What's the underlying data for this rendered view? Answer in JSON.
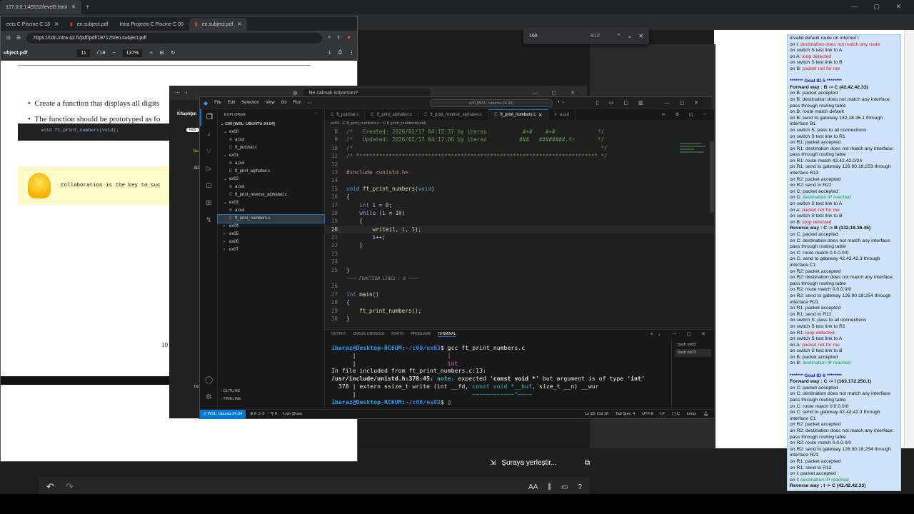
{
  "browser_tab_top": {
    "url_tab": "127.0.0.1:49152/level9.html"
  },
  "find_bar": {
    "query": "168",
    "count": "3/12"
  },
  "pdf": {
    "tabs": [
      "ects C Piscine C 13",
      "en.subject.pdf",
      "Intra Projects C Piscine C 00",
      "en.subject.pdf"
    ],
    "url": "https://cdn.intra.42.fr/pdf/pdf/197175/en.subject.pdf",
    "title": "ubject.pdf",
    "page": "11",
    "total": "/ 18",
    "zoom": "137%",
    "bullet1": "Create a function that displays all digits",
    "bullet2": "The function should be prototyped as fo",
    "code": "void ft_print_numbers(void);",
    "tip": "Collaboration is the key to suc",
    "page_number": "10"
  },
  "edge": {
    "address": "Ne calmak istiyorsun?",
    "sidebar_title": "Kitaplığın",
    "chip": "Indir",
    "label_bu": "bu",
    "label_ad": "AD",
    "label_he": "He"
  },
  "vscode": {
    "menu": [
      "File",
      "Edit",
      "Selection",
      "View",
      "Go",
      "Run"
    ],
    "search": "c00 [WSL: Ubuntu-24.04]",
    "explorer_header": "EXPLORER",
    "root": "C00 [WSL: UBUNTU-24.04]",
    "tree": [
      {
        "label": "ex00",
        "type": "folder",
        "open": true,
        "depth": 0
      },
      {
        "label": "a.out",
        "type": "file",
        "depth": 1
      },
      {
        "label": "ft_putchar.c",
        "type": "c",
        "depth": 1
      },
      {
        "label": "ex01",
        "type": "folder",
        "open": true,
        "depth": 0
      },
      {
        "label": "a.out",
        "type": "file",
        "depth": 1
      },
      {
        "label": "ft_print_alphabet.c",
        "type": "c",
        "depth": 1
      },
      {
        "label": "ex02",
        "type": "folder",
        "open": true,
        "depth": 0
      },
      {
        "label": "a.out",
        "type": "file",
        "depth": 1
      },
      {
        "label": "ft_print_reverse_alphabet.c",
        "type": "c",
        "depth": 1
      },
      {
        "label": "ex03",
        "type": "folder",
        "open": true,
        "depth": 0
      },
      {
        "label": "a.out",
        "type": "file",
        "depth": 1
      },
      {
        "label": "ft_print_numbers.c",
        "type": "c",
        "depth": 1,
        "selected": true
      },
      {
        "label": "ex04",
        "type": "folder",
        "open": false,
        "depth": 0
      },
      {
        "label": "ex05",
        "type": "folder",
        "open": false,
        "depth": 0
      },
      {
        "label": "ex06",
        "type": "folder",
        "open": false,
        "depth": 0
      },
      {
        "label": "ex07",
        "type": "folder",
        "open": false,
        "depth": 0
      }
    ],
    "outline": "OUTLINE",
    "timeline": "TIMELINE",
    "tabs": [
      {
        "label": "ft_putchar.c",
        "active": false
      },
      {
        "label": "ft_print_alphabet.c",
        "active": false
      },
      {
        "label": "ft_print_reverse_alphabet.c",
        "active": false
      },
      {
        "label": "ft_print_numbers.c",
        "active": true
      },
      {
        "label": "a.out",
        "active": false
      }
    ],
    "breadcrumb": "ex03 › C ft_print_numbers.c › ⊙ ft_print_numbers(void)",
    "code_lines": [
      {
        "n": "8",
        "html": "<span class='cm'>/*   Created: 2026/02/17 04:15:37 by ibaraz           #+#    #+#             */</span>"
      },
      {
        "n": "9",
        "html": "<span class='cm'>/*   Updated: 2026/02/17 04:17:06 by ibaraz          ###   ########.fr       */</span>"
      },
      {
        "n": "10",
        "html": "<span class='cm'>/*                                                                            */</span>"
      },
      {
        "n": "11",
        "html": "<span class='cm'>/* ************************************************************************** */</span>"
      },
      {
        "n": "12",
        "html": ""
      },
      {
        "n": "13",
        "html": "<span class='mac'>#include</span> <span class='str'>&lt;unistd.h&gt;</span>"
      },
      {
        "n": "14",
        "html": ""
      },
      {
        "n": "15",
        "html": "<span class='k'>void</span> <span class='f'>ft_print_numbers</span>(<span class='k'>void</span>)"
      },
      {
        "n": "16",
        "html": "{"
      },
      {
        "n": "17",
        "html": "    <span class='k'>int</span> <span class='var'>i</span> = <span class='num'>0</span>;"
      },
      {
        "n": "18",
        "html": "    <span class='kc'>while</span> (<span class='var'>i</span> &lt; <span class='num'>10</span>)"
      },
      {
        "n": "19",
        "html": "    {"
      },
      {
        "n": "20",
        "html": "        <span class='f'>write</span>(<span class='num'>1</span>, <span class='var'>i</span>, <span class='num'>1</span>);",
        "current": true
      },
      {
        "n": "21",
        "html": "        <span class='var'>i</span>++;"
      },
      {
        "n": "22",
        "html": "    }"
      },
      {
        "n": "23",
        "html": ""
      },
      {
        "n": "24",
        "html": ""
      },
      {
        "n": "25",
        "html": "}"
      },
      {
        "n": "",
        "html": "<span class='dim'>──── FUNCTION LINES : 8 ────</span>"
      },
      {
        "n": "26",
        "html": ""
      },
      {
        "n": "27",
        "html": "<span class='k'>int</span> <span class='f'>main</span>()"
      },
      {
        "n": "28",
        "html": "{"
      },
      {
        "n": "29",
        "html": "    <span class='f'>ft_print_numbers</span>();"
      },
      {
        "n": "30",
        "html": "}"
      }
    ],
    "panel_tabs": [
      "OUTPUT",
      "DEBUG CONSOLE",
      "PORTS",
      "PROBLEMS",
      "TERMINAL"
    ],
    "terminal_lines": [
      "<span class='pr'>ibaraz@Desktop-RC6UM</span>:<span class='pp'>~/c00/ex03</span>$ gcc ft_print_numbers.c",
      "      |                          <span class='mag'>|</span>",
      "      |                          <span class='mag'>int</span>",
      "In file included from ft_print_numbers.c:13:",
      "<span class='bold2'>/usr/include/unistd.h:378:45:</span> <span class='teal bold2'>note:</span> expected ‘<span class='bold2'>const void *</span>’ but argument is of type ‘<span class='bold2'>int</span>’",
      "  378 | extern ssize_t write (int __fd, <span class='teal'>const void *__buf</span>, size_t __n) __wur",
      "      |                                 <span class='teal'>~~~~~~~~~~~~^~~~~</span>",
      "<span class='pr'>ibaraz@Desktop-RC6UM</span>:<span class='pp'>~/c00/ex03</span>$ ▯"
    ],
    "terminals": [
      "bash  ex00",
      "bash  ex03"
    ],
    "status": {
      "remote": "WSL: Ubuntu-24.04",
      "errors": "⊗ 0 ⚠ 0",
      "ports": "⚲ 0",
      "live": "Live Share",
      "position": "Ln 20, Col 18",
      "tab": "Tab Size: 4",
      "enc": "UTF-8",
      "eol": "LF",
      "lang": "{ } C",
      "os": "Linux"
    }
  },
  "log": [
    {
      "t": "invalid default route on internet I",
      "c": ""
    },
    {
      "t": "on I: ",
      "c": "",
      "x": "destination does not match any route",
      "xc": "red"
    },
    {
      "t": "on switch S test link to A",
      "c": ""
    },
    {
      "t": "on A: ",
      "c": "",
      "x": "loop detected",
      "xc": "red"
    },
    {
      "t": "on switch S test link to B",
      "c": ""
    },
    {
      "t": "on B: ",
      "c": "",
      "x": "packet not for me",
      "xc": "red"
    },
    {
      "t": "",
      "c": ""
    },
    {
      "t": "******* Goal ID 5 ********",
      "c": "blu"
    },
    {
      "t": "Forward way",
      "c": "bold",
      "x": " : B -> C (42.42.42.33)",
      "xc": ""
    },
    {
      "t": "on B: packet accepted",
      "c": ""
    },
    {
      "t": "on B: destination does not match any interface: pass through routing table",
      "c": "wrap"
    },
    {
      "t": "on B: route match default",
      "c": ""
    },
    {
      "t": "on B: send to gateway 132.18.36.1 through interface B1",
      "c": "wrap"
    },
    {
      "t": "on switch S: pass to all connections",
      "c": ""
    },
    {
      "t": "on switch S test link to R1",
      "c": ""
    },
    {
      "t": "on R1: packet accepted",
      "c": ""
    },
    {
      "t": "on R1: destination does not match any interface: pass through routing table",
      "c": "wrap"
    },
    {
      "t": "on R1: route match 42.42.42.0/24",
      "c": ""
    },
    {
      "t": "on R1: send to gateway 126.90.18.253 through interface R13",
      "c": "wrap"
    },
    {
      "t": "on R2: packet accepted",
      "c": ""
    },
    {
      "t": "on R2: send to R22",
      "c": ""
    },
    {
      "t": "on C: packet accepted",
      "c": ""
    },
    {
      "t": "on C: ",
      "c": "",
      "x": "destination IP reached",
      "xc": "grn"
    },
    {
      "t": "on switch S test link to A",
      "c": ""
    },
    {
      "t": "on A: ",
      "c": "",
      "x": "packet not for me",
      "xc": "red"
    },
    {
      "t": "on switch S test link to B",
      "c": ""
    },
    {
      "t": "on B: ",
      "c": "",
      "x": "loop detected",
      "xc": "red"
    },
    {
      "t": "Reverse way",
      "c": "bold",
      "x": " : C -> B (132.18.36.45)",
      "xc": ""
    },
    {
      "t": "on C: packet accepted",
      "c": ""
    },
    {
      "t": "on C: destination does not match any interface: pass through routing table",
      "c": "wrap"
    },
    {
      "t": "on C: route match 0.0.0.0/0",
      "c": ""
    },
    {
      "t": "on C: send to gateway 42.42.42.3 through interface C1",
      "c": "wrap"
    },
    {
      "t": "on R2: packet accepted",
      "c": ""
    },
    {
      "t": "on R2: destination does not match any interface: pass through routing table",
      "c": "wrap"
    },
    {
      "t": "on R2: route match 0.0.0.0/0",
      "c": ""
    },
    {
      "t": "on R2: send to gateway 126.90.18.254 through interface R21",
      "c": "wrap"
    },
    {
      "t": "on R1: packet accepted",
      "c": ""
    },
    {
      "t": "on R1: send to R11",
      "c": ""
    },
    {
      "t": "on switch S: pass to all connections",
      "c": ""
    },
    {
      "t": "on switch S test link to R1",
      "c": ""
    },
    {
      "t": "on R1: ",
      "c": "",
      "x": "loop detected",
      "xc": "red"
    },
    {
      "t": "on switch S test link to A",
      "c": ""
    },
    {
      "t": "on A: ",
      "c": "",
      "x": "packet not for me",
      "xc": "red"
    },
    {
      "t": "on switch S test link to B",
      "c": ""
    },
    {
      "t": "on B: packet accepted",
      "c": ""
    },
    {
      "t": "on B: ",
      "c": "",
      "x": "destination IP reached",
      "xc": "grn"
    },
    {
      "t": "",
      "c": ""
    },
    {
      "t": "******* Goal ID 6 ********",
      "c": "blu"
    },
    {
      "t": "Forward way",
      "c": "bold",
      "x": " : C -> I (163.172.250.1)",
      "xc": ""
    },
    {
      "t": "on C: packet accepted",
      "c": ""
    },
    {
      "t": "on C: destination does not match any interface: pass through routing table",
      "c": "wrap"
    },
    {
      "t": "on C: route match 0.0.0.0/0",
      "c": ""
    },
    {
      "t": "on C: send to gateway 42.42.42.3 through interface C1",
      "c": "wrap"
    },
    {
      "t": "on R2: packet accepted",
      "c": ""
    },
    {
      "t": "on R2: destination does not match any interface: pass through routing table",
      "c": "wrap"
    },
    {
      "t": "on R2: route match 0.0.0.0/0",
      "c": ""
    },
    {
      "t": "on R2: send to gateway 126.90.18.254 through interface R21",
      "c": "wrap"
    },
    {
      "t": "on R1: packet accepted",
      "c": ""
    },
    {
      "t": "on R1: send to R12",
      "c": ""
    },
    {
      "t": "on I: packet accepted",
      "c": ""
    },
    {
      "t": "on I: ",
      "c": "",
      "x": "destination IP reached",
      "xc": "grn"
    },
    {
      "t": "Reverse way",
      "c": "bold",
      "x": " : I -> C (42.42.42.33)",
      "xc": ""
    },
    {
      "t": "on I: packet accepted",
      "c": ""
    }
  ],
  "bottom": {
    "paste": "Şuraya yerleştir...",
    "text_btn": "AA"
  }
}
